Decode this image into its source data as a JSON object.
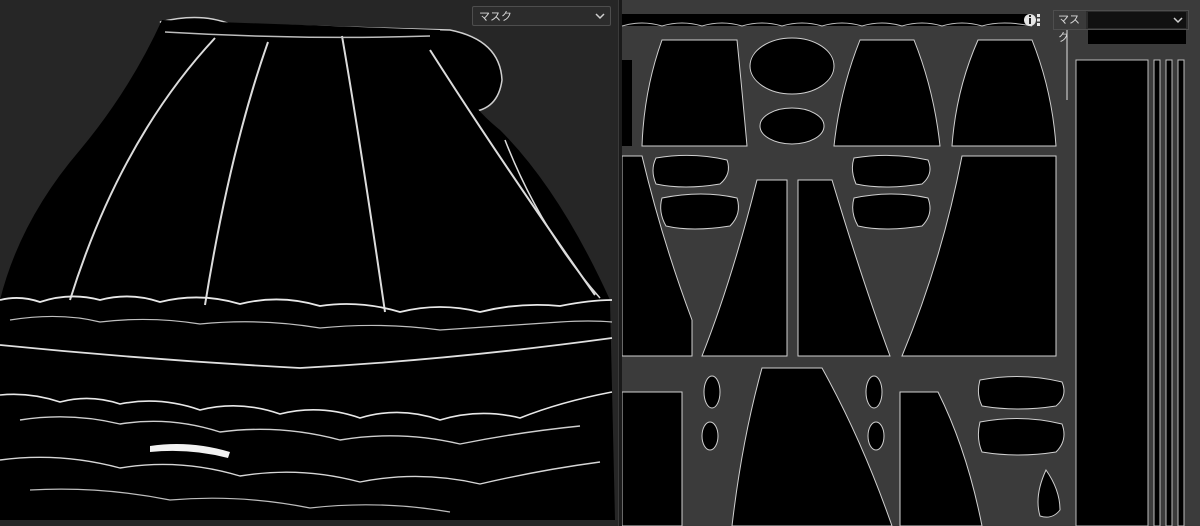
{
  "viewport_3d": {
    "channel_dropdown": {
      "value": "マスク",
      "icon": "chevron-down-icon"
    }
  },
  "uv_editor": {
    "channel_dropdown": {
      "value": "マスク",
      "icon": "chevron-down-icon"
    },
    "info_icon": "info-icon"
  },
  "colors": {
    "background": "#262626",
    "uv_background": "#3b3b3b",
    "mask_fill": "#000000",
    "seam_highlight": "#f2f2f2"
  }
}
